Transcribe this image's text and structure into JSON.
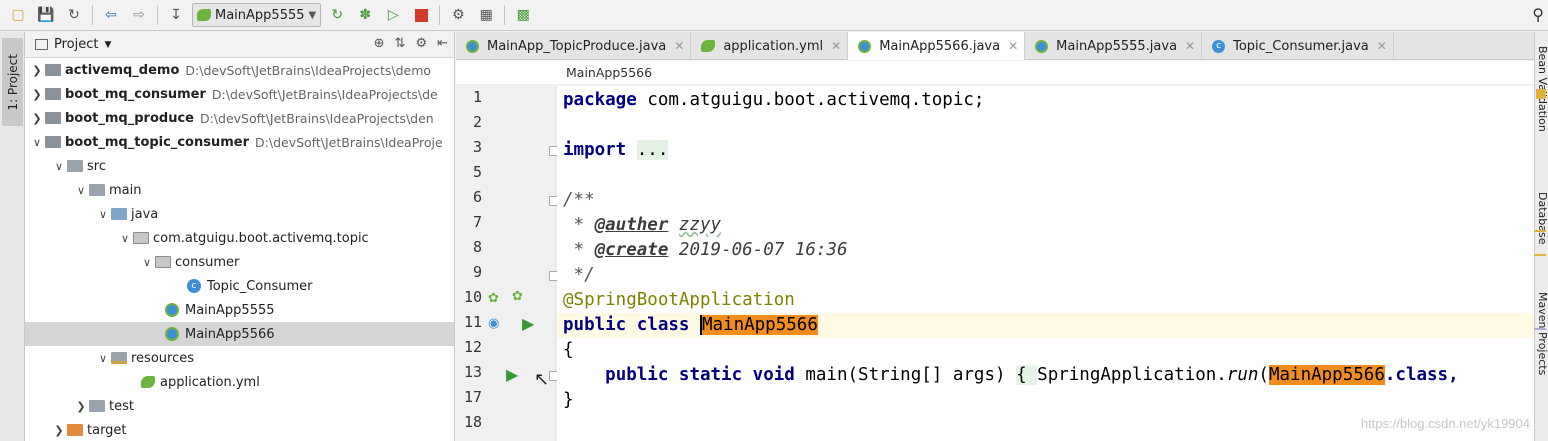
{
  "toolbar": {
    "run_config": "MainApp5555"
  },
  "left_stripe": {
    "project_tab": "1: Project"
  },
  "project": {
    "title": "Project",
    "tree": [
      {
        "label": "activemq_demo",
        "path": "D:\\devSoft\\JetBrains\\IdeaProjects\\demo"
      },
      {
        "label": "boot_mq_consumer",
        "path": "D:\\devSoft\\JetBrains\\IdeaProjects\\de"
      },
      {
        "label": "boot_mq_produce",
        "path": "D:\\devSoft\\JetBrains\\IdeaProjects\\den"
      },
      {
        "label": "boot_mq_topic_consumer",
        "path": "D:\\devSoft\\JetBrains\\IdeaProje"
      },
      {
        "label": "src"
      },
      {
        "label": "main"
      },
      {
        "label": "java"
      },
      {
        "label": "com.atguigu.boot.activemq.topic"
      },
      {
        "label": "consumer"
      },
      {
        "label": "Topic_Consumer"
      },
      {
        "label": "MainApp5555"
      },
      {
        "label": "MainApp5566"
      },
      {
        "label": "resources"
      },
      {
        "label": "application.yml"
      },
      {
        "label": "test"
      },
      {
        "label": "target"
      }
    ]
  },
  "tabs": [
    {
      "label": "MainApp_TopicProduce.java"
    },
    {
      "label": "application.yml"
    },
    {
      "label": "MainApp5566.java"
    },
    {
      "label": "MainApp5555.java"
    },
    {
      "label": "Topic_Consumer.java"
    }
  ],
  "breadcrumb": "MainApp5566",
  "line_numbers": [
    "1",
    "2",
    "3",
    "5",
    "6",
    "7",
    "8",
    "9",
    "10",
    "11",
    "12",
    "13",
    "17",
    "18"
  ],
  "code": {
    "l1_kw": "package",
    "l1_rest": " com.atguigu.boot.activemq.topic;",
    "l3_kw": "import",
    "l3_rest": "...",
    "l6": "/**",
    "l7_star": " * ",
    "l7_tag": "@auther",
    "l7_val": "zzyy",
    "l8_star": " * ",
    "l8_tag": "@create",
    "l8_val": "2019-06-07 16:36",
    "l9": " */",
    "l10": "@SpringBootApplication",
    "l11_kw": "public class ",
    "l11_name": "MainApp5566",
    "l12": "{",
    "l13_indent": "    ",
    "l13_kw": "public static void",
    "l13_sig": " main(String[] args) ",
    "l13_body_open": "{ ",
    "l13_call": "SpringApplication.",
    "l13_run": "run",
    "l13_paren": "(",
    "l13_cls": "MainApp5566",
    "l13_tail": ".class,",
    "l17": "}"
  },
  "right_stripe": {
    "bean_validation": "Bean Validation",
    "database": "Database",
    "maven": "Maven Projects"
  },
  "watermark": "https://blog.csdn.net/yk19904"
}
